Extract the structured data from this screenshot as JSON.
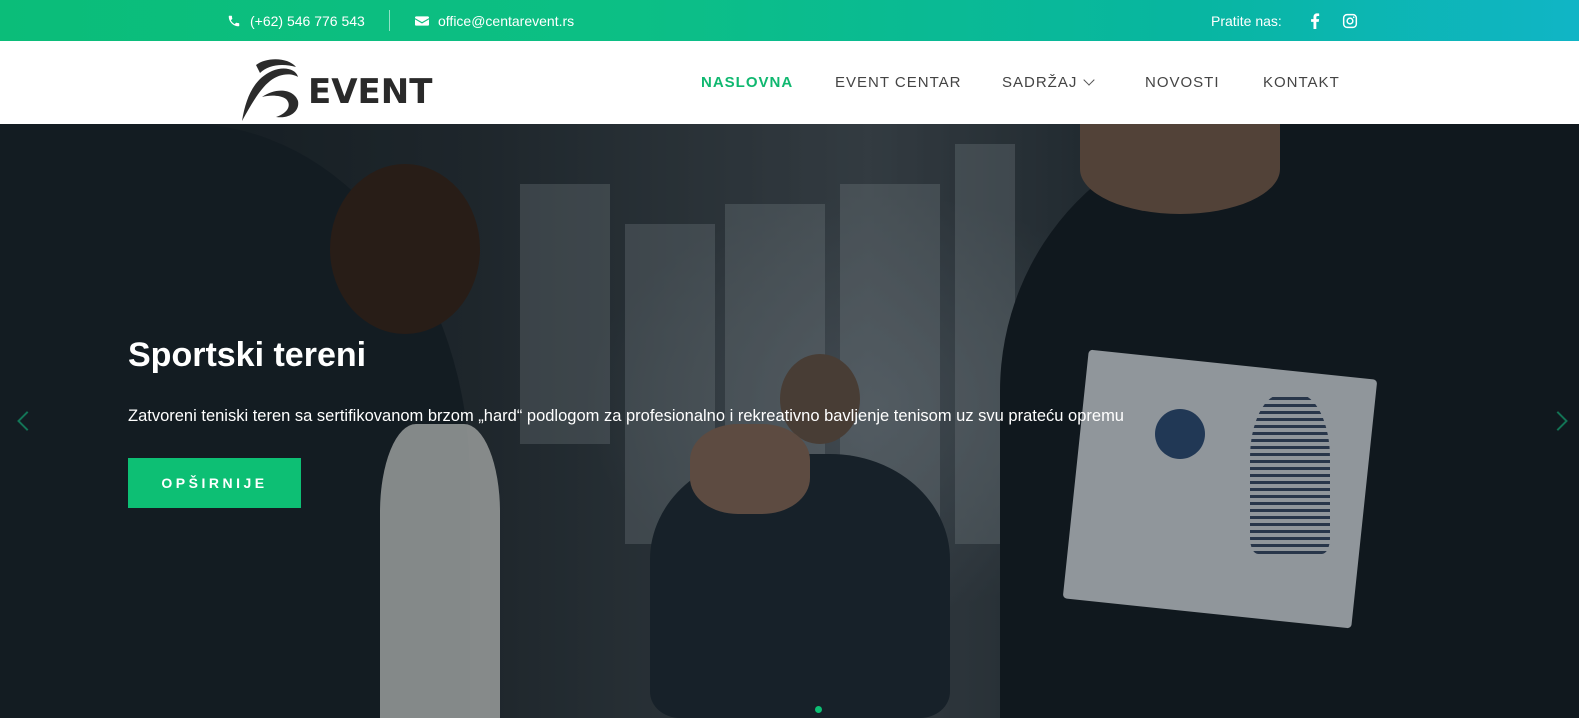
{
  "topbar": {
    "phone": "(+62) 546 776 543",
    "email": "office@centarevent.rs",
    "follow_label": "Pratite nas:",
    "social": [
      "facebook-icon",
      "instagram-icon"
    ]
  },
  "header": {
    "logo_text": "EVENT",
    "nav": [
      "NASLOVNA",
      "EVENT CENTAR",
      "SADRŽAJ",
      "NOVOSTI",
      "KONTAKT"
    ],
    "active_nav": "NASLOVNA"
  },
  "hero": {
    "title": "Sportski tereni",
    "text": "Zatvoreni teniski teren sa sertifikovanom brzom „hard“ podlogom za profesionalno i rekreativno bavljenje tenisom uz svu prateću opremu",
    "button": "OPŠIRNIJE"
  },
  "colors": {
    "accent": "#0dbf74",
    "topbar_start": "#0bbd79",
    "topbar_end": "#10b5c6",
    "nav_text": "#444444"
  }
}
